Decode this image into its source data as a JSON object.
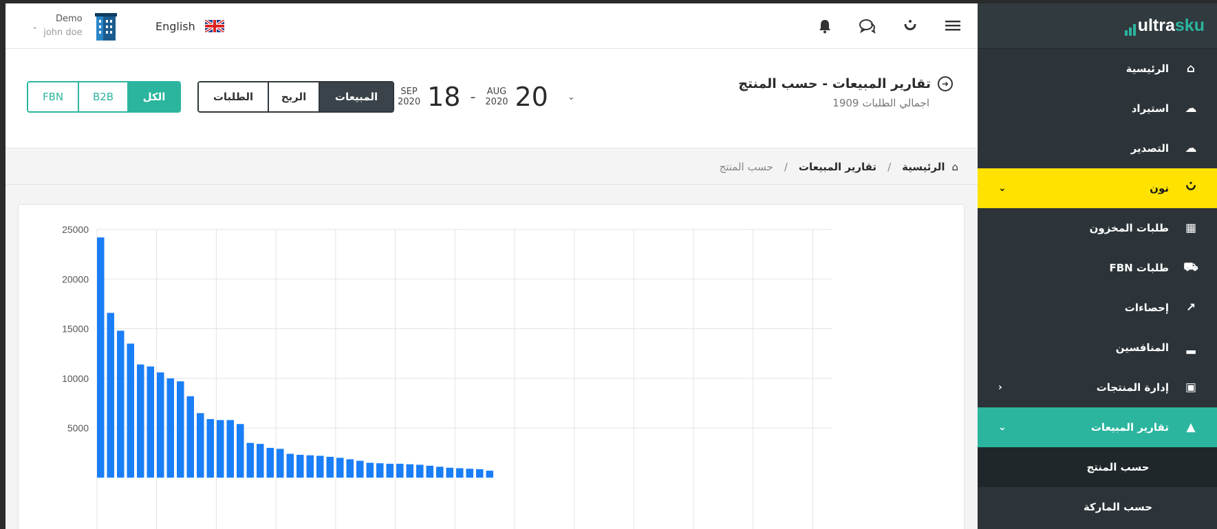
{
  "brand": {
    "name_main": "ultra",
    "name_accent": "sku"
  },
  "topbar": {
    "user_company": "Demo",
    "user_name": "john doe",
    "language": "English"
  },
  "sidebar": {
    "items": [
      {
        "label": "الرئيسية",
        "icon": "home-icon"
      },
      {
        "label": "استيراد",
        "icon": "cloud-upload-icon"
      },
      {
        "label": "التصدير",
        "icon": "cloud-download-icon"
      },
      {
        "label": "نون",
        "icon": "noon-icon"
      },
      {
        "label": "طلبات المخزون",
        "icon": "boxes-icon"
      },
      {
        "label": "طلبات FBN",
        "icon": "truck-icon"
      },
      {
        "label": "إحصاءات",
        "icon": "stats-icon"
      },
      {
        "label": "المنافسين",
        "icon": "bar-chart-icon"
      },
      {
        "label": "إدارة المنتجات",
        "icon": "cart-icon"
      },
      {
        "label": "تقارير المبيعات",
        "icon": "area-chart-icon"
      }
    ],
    "sub_items": [
      {
        "label": "حسب المنتج"
      },
      {
        "label": "حسب الماركة"
      }
    ],
    "colors": {
      "background": "#2c3439",
      "noon_highlight": "#ffe200",
      "active": "#2bb59f"
    }
  },
  "header": {
    "title": "تقارير المبيعات - حسب المنتج",
    "subtitle": "اجمالي الطلبات 1909",
    "date_from": {
      "month": "AUG",
      "year": "2020",
      "day": "20"
    },
    "date_to": {
      "month": "SEP",
      "year": "2020",
      "day": "18"
    },
    "metric_tabs": [
      {
        "label": "المبيعات",
        "active": true
      },
      {
        "label": "الربح",
        "active": false
      },
      {
        "label": "الطلبات",
        "active": false
      }
    ],
    "channel_tabs": [
      {
        "label": "الكل",
        "active": true
      },
      {
        "label": "B2B",
        "active": false
      },
      {
        "label": "FBN",
        "active": false
      }
    ]
  },
  "breadcrumb": {
    "items": [
      "الرئيسية",
      "تقارير المبيعات",
      "حسب المنتج"
    ]
  },
  "chart_data": {
    "type": "bar",
    "title": "",
    "xlabel": "",
    "ylabel": "",
    "ylim": [
      0,
      25000
    ],
    "yticks": [
      5000,
      10000,
      15000,
      20000,
      25000
    ],
    "grid": true,
    "color": "#1a7ef7",
    "values": [
      24200,
      16600,
      14800,
      13500,
      11400,
      11200,
      10600,
      10000,
      9700,
      8200,
      6500,
      5900,
      5800,
      5800,
      5400,
      3500,
      3400,
      3000,
      2900,
      2400,
      2300,
      2250,
      2200,
      2100,
      2000,
      1850,
      1700,
      1500,
      1450,
      1400,
      1400,
      1350,
      1300,
      1200,
      1100,
      1000,
      950,
      900,
      850,
      700
    ]
  }
}
